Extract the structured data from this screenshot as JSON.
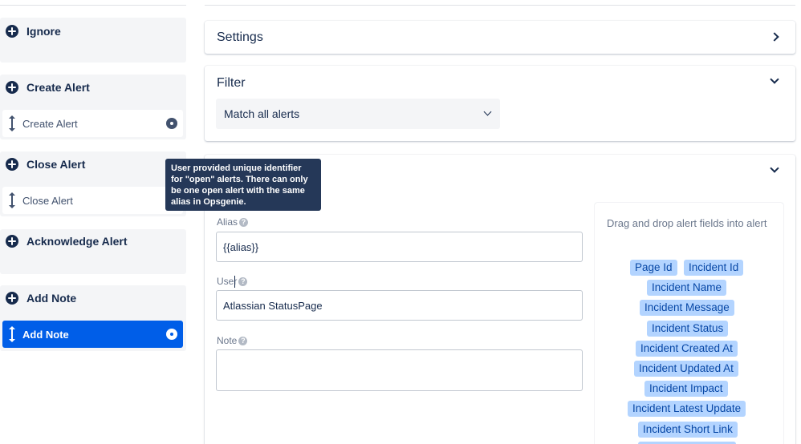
{
  "left": {
    "groups": [
      {
        "title": "Ignore",
        "items": []
      },
      {
        "title": "Create Alert",
        "items": [
          {
            "label": "Create Alert",
            "active": false
          }
        ]
      },
      {
        "title": "Close Alert",
        "items": [
          {
            "label": "Close Alert",
            "active": false
          }
        ]
      },
      {
        "title": "Acknowledge Alert",
        "items": []
      },
      {
        "title": "Add Note",
        "items": [
          {
            "label": "Add Note",
            "active": true
          }
        ]
      }
    ]
  },
  "panels": {
    "settings": {
      "title": "Settings"
    },
    "filter": {
      "title": "Filter",
      "select_value": "Match all alerts"
    },
    "action": {
      "fields": [
        {
          "label": "Alias",
          "value": "{{alias}}"
        },
        {
          "label": "User",
          "value": "Atlassian StatusPage"
        },
        {
          "label": "Note",
          "value": ""
        }
      ],
      "dnd_hint": "Drag and drop alert fields into alert",
      "tags": [
        "Page Id",
        "Incident Id",
        "Incident Name",
        "Incident Message",
        "Incident Status",
        "Incident Created At",
        "Incident Updated At",
        "Incident Impact",
        "Incident Latest Update",
        "Incident Short Link"
      ]
    }
  },
  "tooltip": {
    "text": "User provided unique identifier for \"open\" alerts. There can only be one open alert with the same alias in Opsgenie."
  },
  "colors": {
    "active_item": "#005ee8",
    "tag_bg": "#b3d4ff",
    "tooltip_bg": "#253858"
  }
}
